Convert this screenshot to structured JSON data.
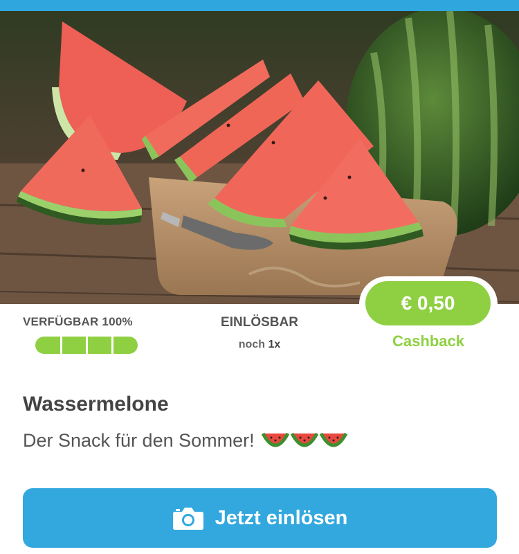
{
  "header": {
    "accent_color": "#2fa6dd"
  },
  "hero_image": {
    "subject": "watermelon slices on wooden cutting board"
  },
  "availability": {
    "label": "VERFÜGBAR",
    "percent_text": "100%",
    "progress_fraction": 1.0,
    "segments": 4,
    "color": "#8fd042"
  },
  "redeemable": {
    "title": "EINLÖSBAR",
    "prefix": "noch",
    "count": "1x"
  },
  "price": {
    "amount": "€ 0,50",
    "label": "Cashback",
    "color": "#8fd042"
  },
  "product": {
    "title": "Wassermelone",
    "description": "Der Snack für den Sommer!",
    "emoji_icons": [
      "watermelon-icon",
      "watermelon-icon",
      "watermelon-icon"
    ]
  },
  "cta": {
    "label": "Jetzt einlösen",
    "icon": "camera-icon",
    "color": "#32a8df"
  }
}
